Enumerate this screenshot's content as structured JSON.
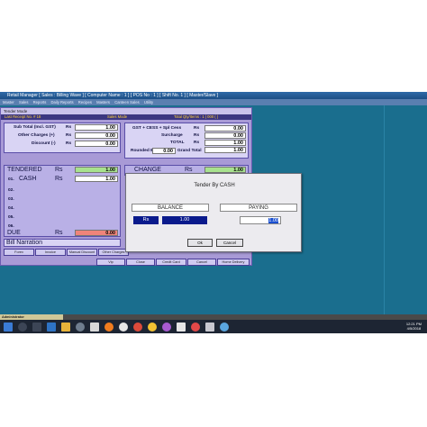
{
  "app": {
    "title": "Retail Manager  [ Sales : Billing Wave ]  [ Computer Name : 1 ]  [ POS No : 1 ]  [ Shift No. 1 ]  [ Master/Slave ]",
    "menu": [
      "Master",
      "Sales",
      "Reports",
      "Daily Reports",
      "Recipes",
      "Masters",
      "Canteen Sales",
      "Utility"
    ]
  },
  "tender": {
    "window_title": "Tender Mode",
    "header_left": "Last Receipt No. # 18",
    "header_mid": "Sales Mode",
    "header_right": "Total Qty/Items : 1 | 000 (  )  ",
    "subtotal_label": "Sub Total (Incl. GST)",
    "subtotal_unit": "Rs",
    "subtotal_value": "1.00",
    "other_charges_label": "Other Charges (+)",
    "other_charges_unit": "Rs",
    "other_charges_value": "0.00",
    "discount_label": "Discount (-)",
    "discount_unit": "Rs",
    "discount_value": "0.00",
    "gst_label": "GST + CESS + Spl Cess",
    "gst_unit": "Rs",
    "gst_value": "0.00",
    "surcharge_label": "Surcharge",
    "surcharge_unit": "Rs",
    "surcharge_value": "0.00",
    "total_label": "TOTAL",
    "total_unit": "Rs",
    "total_value": "1.00",
    "rounded_label": "Rounded By",
    "rounded_value": "0.00",
    "grand_total_label": "Grand Total",
    "grand_total_value": "1.00",
    "tendered_label": "TENDERED",
    "tendered_unit": "Rs",
    "tendered_value": "1.00",
    "cash_num": "01.",
    "cash_label": "CASH",
    "cash_unit": "Rs",
    "cash_value": "1.00",
    "line_nums": [
      "02.",
      "03.",
      "04.",
      "05.",
      "06."
    ],
    "change_label": "CHANGE",
    "change_unit": "Rs",
    "change_value": "1.00",
    "due_label": "DUE",
    "due_unit": "Rs",
    "due_value": "0.00",
    "bill_narration_label": "Bill Narration",
    "buttons_row1": [
      "Forex",
      "Invoice",
      "Manual Discount",
      "Other Charges"
    ],
    "buttons_row2": [
      "Vip",
      "Close",
      "Credit Card",
      "Cancel",
      "Home Delivery"
    ]
  },
  "dialog": {
    "title": "Tender By CASH",
    "balance_header": "BALANCE",
    "paying_header": "PAYING",
    "balance_unit": "Rs",
    "balance_value": "1.00",
    "paying_value": "1.00",
    "ok_label": "Ok",
    "cancel_label": "Cancel"
  },
  "status": {
    "user": "Administrator"
  },
  "taskbar": {
    "time": "12:21 PM",
    "date": "4/5/2018",
    "icons": [
      "start-icon",
      "search-icon",
      "task-view-icon",
      "folder-icon",
      "media-icon",
      "chrome-icon",
      "firefox-icon",
      "app-icon",
      "store-icon",
      "paint-icon",
      "window-icon"
    ],
    "colors": {
      "taskbar": "#1d2533",
      "desktop": "#1a6e8e",
      "panel": "#a89ad6"
    }
  }
}
